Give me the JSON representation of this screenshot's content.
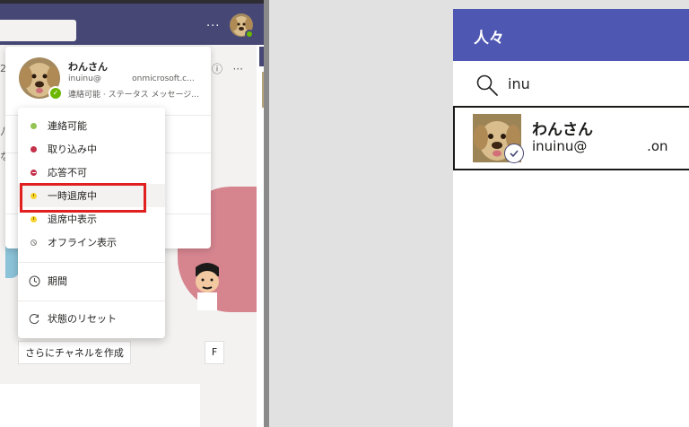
{
  "titlebar": {
    "more_label": "···",
    "avatar_icon": "dog-avatar-icon"
  },
  "channel": {
    "info_icon": "ⓘ",
    "more_label": "···",
    "left_fragments": [
      "2",
      "ﾉ",
      "な"
    ]
  },
  "profile_card": {
    "name": "わんさん",
    "email": "inuinu@            onmicrosoft.c...",
    "status_line": "連絡可能 ·  ステータス メッセージ..."
  },
  "status_menu": {
    "items": [
      {
        "label": "連絡可能",
        "icon": "available-dot",
        "color": "#92c353"
      },
      {
        "label": "取り込み中",
        "icon": "busy-dot",
        "color": "#c4314b"
      },
      {
        "label": "応答不可",
        "icon": "do-not-disturb-dot",
        "color": "#c4314b"
      },
      {
        "label": "一時退席中",
        "icon": "be-right-back-dot",
        "color": "#f8d22a"
      },
      {
        "label": "退席中表示",
        "icon": "away-dot",
        "color": "#f8d22a"
      },
      {
        "label": "オフライン表示",
        "icon": "offline-dot",
        "color": "#8a8886"
      }
    ],
    "duration_label": "期間",
    "reset_label": "状態のリセット",
    "highlighted": "一時退席中"
  },
  "channel_actions": {
    "create_more_label": "さらにチャネルを作成",
    "side_button_label": "F"
  },
  "people": {
    "title": "人々",
    "search_value": "inu",
    "result": {
      "name": "わんさん",
      "email": "inuinu@              .on"
    }
  },
  "colors": {
    "teams_header": "#464775",
    "people_header": "#4e57b2",
    "highlight_border": "#e02020",
    "available": "#6bb700"
  }
}
